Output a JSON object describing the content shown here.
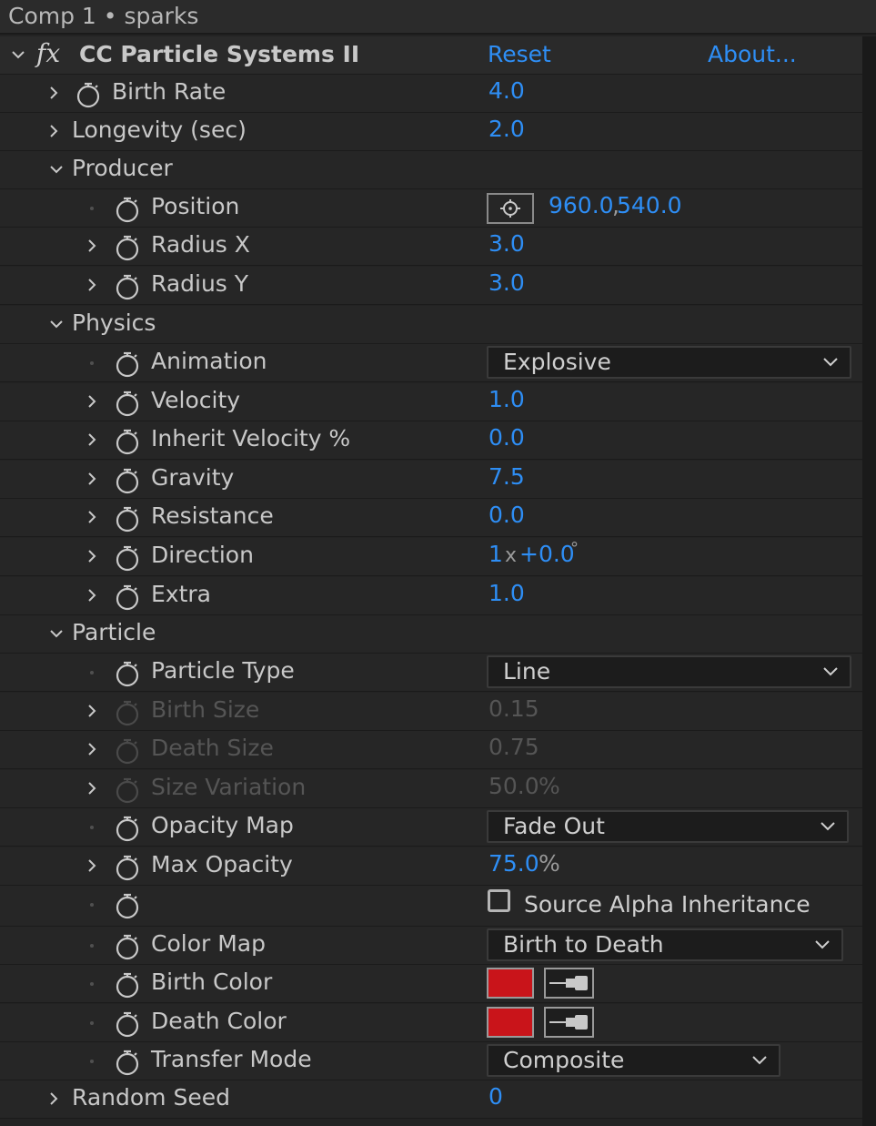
{
  "title": "Comp 1 • sparks",
  "effect": {
    "name": "CC Particle Systems II",
    "reset_label": "Reset",
    "about_label": "About..."
  },
  "rows": {
    "birth_rate": {
      "label": "Birth Rate",
      "value": "4.0"
    },
    "longevity": {
      "label": "Longevity (sec)",
      "value": "2.0"
    },
    "producer": {
      "label": "Producer"
    },
    "position": {
      "label": "Position",
      "value": "960.0",
      "value2": "540.0",
      "sep": ","
    },
    "radius_x": {
      "label": "Radius X",
      "value": "3.0"
    },
    "radius_y": {
      "label": "Radius Y",
      "value": "3.0"
    },
    "physics": {
      "label": "Physics"
    },
    "animation": {
      "label": "Animation",
      "value": "Explosive"
    },
    "velocity": {
      "label": "Velocity",
      "value": "1.0"
    },
    "inherit_velocity": {
      "label": "Inherit Velocity %",
      "value": "0.0"
    },
    "gravity": {
      "label": "Gravity",
      "value": "7.5"
    },
    "resistance": {
      "label": "Resistance",
      "value": "0.0"
    },
    "direction": {
      "label": "Direction",
      "revolutions": "1",
      "x_sign": "x",
      "degrees": "+0.0",
      "deg_symbol": "°"
    },
    "extra": {
      "label": "Extra",
      "value": "1.0"
    },
    "particle": {
      "label": "Particle"
    },
    "particle_type": {
      "label": "Particle Type",
      "value": "Line"
    },
    "birth_size": {
      "label": "Birth Size",
      "value": "0.15"
    },
    "death_size": {
      "label": "Death Size",
      "value": "0.75"
    },
    "size_variation": {
      "label": "Size Variation",
      "value": "50.0",
      "unit": "%"
    },
    "opacity_map": {
      "label": "Opacity Map",
      "value": "Fade Out"
    },
    "max_opacity": {
      "label": "Max Opacity",
      "value": "75.0",
      "unit": "%"
    },
    "source_alpha": {
      "label": "Source Alpha Inheritance",
      "checked": false
    },
    "color_map": {
      "label": "Color Map",
      "value": "Birth to Death"
    },
    "birth_color": {
      "label": "Birth Color",
      "color": "#c9141a"
    },
    "death_color": {
      "label": "Death Color",
      "color": "#c9141a"
    },
    "transfer_mode": {
      "label": "Transfer Mode",
      "value": "Composite"
    },
    "random_seed": {
      "label": "Random Seed",
      "value": "0"
    }
  },
  "colors": {
    "accent": "#2e8ef5",
    "background": "#232323",
    "swatch": "#c9141a"
  },
  "icons": [
    "chevron-right-icon",
    "chevron-down-icon",
    "stopwatch-icon",
    "fx-icon",
    "target-icon",
    "eyedropper-icon",
    "caret-down-icon"
  ]
}
